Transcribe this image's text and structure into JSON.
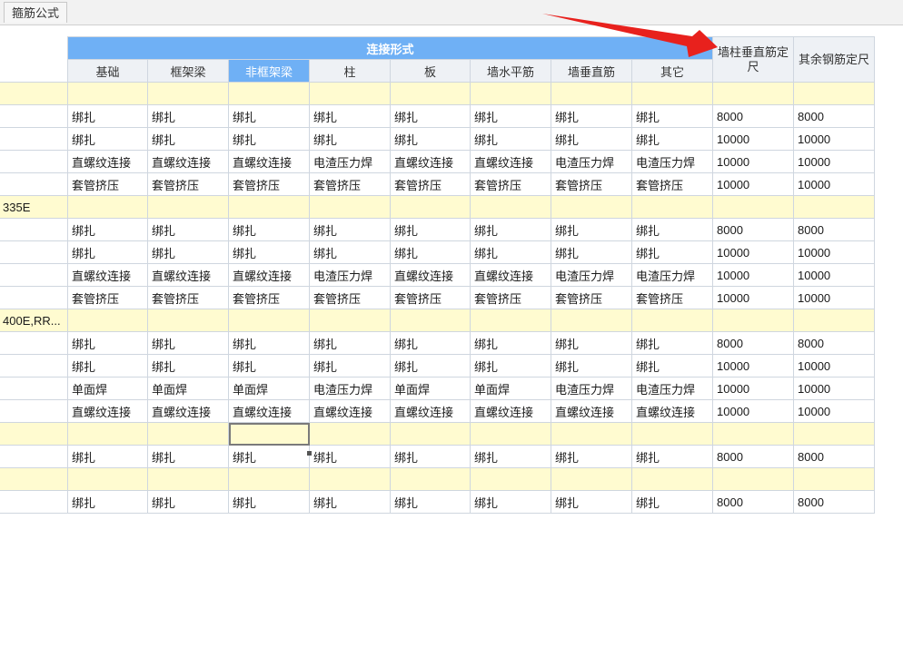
{
  "tab": {
    "label": "箍筋公式"
  },
  "header": {
    "group_label": "连接形式",
    "columns": [
      "基础",
      "框架梁",
      "非框架梁",
      "柱",
      "板",
      "墙水平筋",
      "墙垂直筋",
      "其它"
    ],
    "active_column": "非框架梁",
    "side_columns": [
      "墙柱垂直筋定尺",
      "其余钢筋定尺"
    ]
  },
  "rows": [
    {
      "type": "section",
      "label": ""
    },
    {
      "type": "data",
      "label": "",
      "cells": [
        "绑扎",
        "绑扎",
        "绑扎",
        "绑扎",
        "绑扎",
        "绑扎",
        "绑扎",
        "绑扎",
        "8000",
        "8000"
      ]
    },
    {
      "type": "data",
      "label": "",
      "cells": [
        "绑扎",
        "绑扎",
        "绑扎",
        "绑扎",
        "绑扎",
        "绑扎",
        "绑扎",
        "绑扎",
        "10000",
        "10000"
      ]
    },
    {
      "type": "data",
      "label": "",
      "cells": [
        "直螺纹连接",
        "直螺纹连接",
        "直螺纹连接",
        "电渣压力焊",
        "直螺纹连接",
        "直螺纹连接",
        "电渣压力焊",
        "电渣压力焊",
        "10000",
        "10000"
      ]
    },
    {
      "type": "data",
      "label": "",
      "cells": [
        "套管挤压",
        "套管挤压",
        "套管挤压",
        "套管挤压",
        "套管挤压",
        "套管挤压",
        "套管挤压",
        "套管挤压",
        "10000",
        "10000"
      ]
    },
    {
      "type": "section",
      "label": "335E"
    },
    {
      "type": "data",
      "label": "",
      "cells": [
        "绑扎",
        "绑扎",
        "绑扎",
        "绑扎",
        "绑扎",
        "绑扎",
        "绑扎",
        "绑扎",
        "8000",
        "8000"
      ]
    },
    {
      "type": "data",
      "label": "",
      "cells": [
        "绑扎",
        "绑扎",
        "绑扎",
        "绑扎",
        "绑扎",
        "绑扎",
        "绑扎",
        "绑扎",
        "10000",
        "10000"
      ]
    },
    {
      "type": "data",
      "label": "",
      "cells": [
        "直螺纹连接",
        "直螺纹连接",
        "直螺纹连接",
        "电渣压力焊",
        "直螺纹连接",
        "直螺纹连接",
        "电渣压力焊",
        "电渣压力焊",
        "10000",
        "10000"
      ]
    },
    {
      "type": "data",
      "label": "",
      "cells": [
        "套管挤压",
        "套管挤压",
        "套管挤压",
        "套管挤压",
        "套管挤压",
        "套管挤压",
        "套管挤压",
        "套管挤压",
        "10000",
        "10000"
      ]
    },
    {
      "type": "section",
      "label": "400E,RR..."
    },
    {
      "type": "data",
      "label": "",
      "cells": [
        "绑扎",
        "绑扎",
        "绑扎",
        "绑扎",
        "绑扎",
        "绑扎",
        "绑扎",
        "绑扎",
        "8000",
        "8000"
      ]
    },
    {
      "type": "data",
      "label": "",
      "cells": [
        "绑扎",
        "绑扎",
        "绑扎",
        "绑扎",
        "绑扎",
        "绑扎",
        "绑扎",
        "绑扎",
        "10000",
        "10000"
      ]
    },
    {
      "type": "data",
      "label": "",
      "cells": [
        "单面焊",
        "单面焊",
        "单面焊",
        "电渣压力焊",
        "单面焊",
        "单面焊",
        "电渣压力焊",
        "电渣压力焊",
        "10000",
        "10000"
      ]
    },
    {
      "type": "data",
      "label": "",
      "cells": [
        "直螺纹连接",
        "直螺纹连接",
        "直螺纹连接",
        "直螺纹连接",
        "直螺纹连接",
        "直螺纹连接",
        "直螺纹连接",
        "直螺纹连接",
        "10000",
        "10000"
      ]
    },
    {
      "type": "section",
      "label": "",
      "selected_col": 2
    },
    {
      "type": "data",
      "label": "",
      "cells": [
        "绑扎",
        "绑扎",
        "绑扎",
        "绑扎",
        "绑扎",
        "绑扎",
        "绑扎",
        "绑扎",
        "8000",
        "8000"
      ]
    },
    {
      "type": "section",
      "label": ""
    },
    {
      "type": "data",
      "label": "",
      "cells": [
        "绑扎",
        "绑扎",
        "绑扎",
        "绑扎",
        "绑扎",
        "绑扎",
        "绑扎",
        "绑扎",
        "8000",
        "8000"
      ]
    }
  ],
  "colors": {
    "header_blue": "#6fb0f5",
    "section_yellow": "#fffbd0",
    "arrow_red": "#e8211d"
  },
  "annotation": {
    "icon": "red-arrow-icon"
  }
}
